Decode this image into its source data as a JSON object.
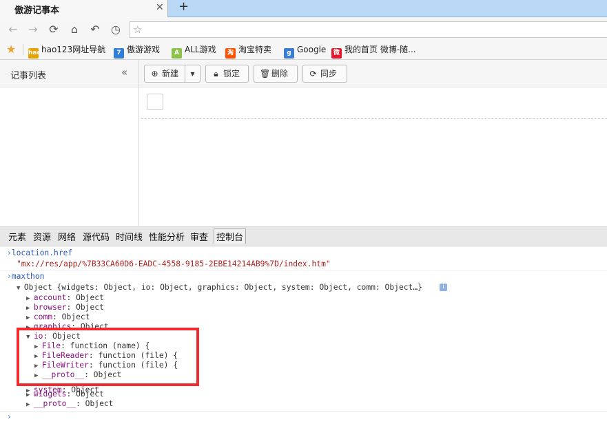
{
  "browser": {
    "tab_title": "傲游记事本",
    "tab_close": "✕",
    "new_tab": "+",
    "address_star": "☆",
    "bookmarks": [
      {
        "label": "hao123网址导航",
        "icon": "hao123-icon",
        "badge": "hao",
        "color": "#e8a200"
      },
      {
        "label": "傲游游戏",
        "icon": "maxthon-game-icon",
        "badge": "7",
        "color": "#2f7ed8"
      },
      {
        "label": "ALL游戏",
        "icon": "all-game-icon",
        "badge": "A",
        "color": "#8bc34a"
      },
      {
        "label": "淘宝特卖",
        "icon": "taobao-icon",
        "badge": "淘",
        "color": "#ff5000"
      },
      {
        "label": "Google",
        "icon": "google-icon",
        "badge": "g",
        "color": "#3a7bd5"
      },
      {
        "label": "我的首页 微博-随...",
        "icon": "weibo-icon",
        "badge": "微",
        "color": "#e6162d"
      }
    ]
  },
  "app": {
    "sidebar_title": "记事列表",
    "collapse_glyph": "«",
    "toolbar": {
      "new_label": "新建",
      "dropdown_glyph": "▾",
      "lock_label": "锁定",
      "delete_label": "删除",
      "sync_label": "同步"
    }
  },
  "devtools": {
    "tabs": [
      "元素",
      "资源",
      "网络",
      "源代码",
      "时间线",
      "性能分析",
      "审查",
      "控制台"
    ],
    "console": {
      "prompt": "›",
      "cmd1": "location.href",
      "result1": "\"mx://res/app/%7B33CA60D6-EADC-4558-9185-2EBE14214AB9%7D/index.htm\"",
      "cmd2": "maxthon",
      "object_summary": "Object {widgets: Object, io: Object, graphics: Object, system: Object, comm: Object…}",
      "info_badge": "i",
      "props": [
        {
          "key": "account",
          "value": "Object"
        },
        {
          "key": "browser",
          "value": "Object"
        },
        {
          "key": "comm",
          "value": "Object"
        },
        {
          "key": "graphics",
          "value": "Object"
        }
      ],
      "io_key": "io",
      "io_value": "Object",
      "io_props": [
        {
          "key": "File",
          "value": "function (name) {"
        },
        {
          "key": "FileReader",
          "value": "function (file) {"
        },
        {
          "key": "FileWriter",
          "value": "function (file) {"
        },
        {
          "key": "__proto__",
          "value": "Object"
        }
      ],
      "system_key": "system",
      "system_value": "Object",
      "tail_props": [
        {
          "key": "widgets",
          "value": "Object"
        },
        {
          "key": "__proto__",
          "value": "Object"
        }
      ]
    }
  }
}
